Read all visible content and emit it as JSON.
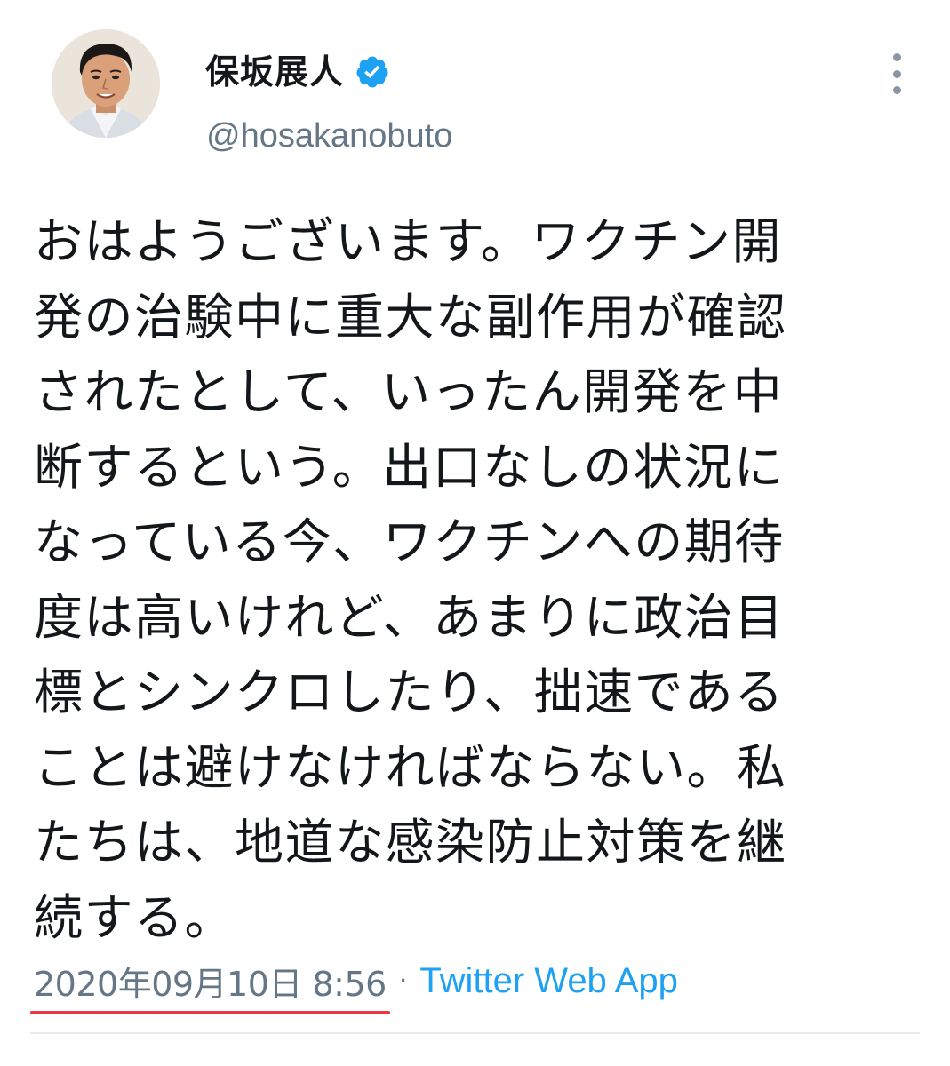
{
  "colors": {
    "name": "#14171a",
    "secondary": "#657786",
    "link": "#1da1f2",
    "verified": "#1da1f2",
    "highlight_underline": "#f2323f"
  },
  "user": {
    "display_name": "保坂展人",
    "handle": "@hosakanobuto",
    "verified_icon": "verified-badge-icon"
  },
  "tweet": {
    "text": "おはようございます。ワクチン開\n発の治験中に重大な副作用が確認\nされたとして、いったん開発を中\n断するという。出口なしの状況に\nなっている今、ワクチンへの期待\n度は高いけれど、あまりに政治目\n標とシンクロしたり、拙速である\nことは避けなければならない。私\nたちは、地道な感染防止対策を継\n続する。",
    "timestamp": "2020年09月10日 8:56",
    "separator": "·",
    "source": "Twitter Web App"
  },
  "icons": {
    "more": "more-vertical-icon",
    "avatar": "profile-photo"
  }
}
